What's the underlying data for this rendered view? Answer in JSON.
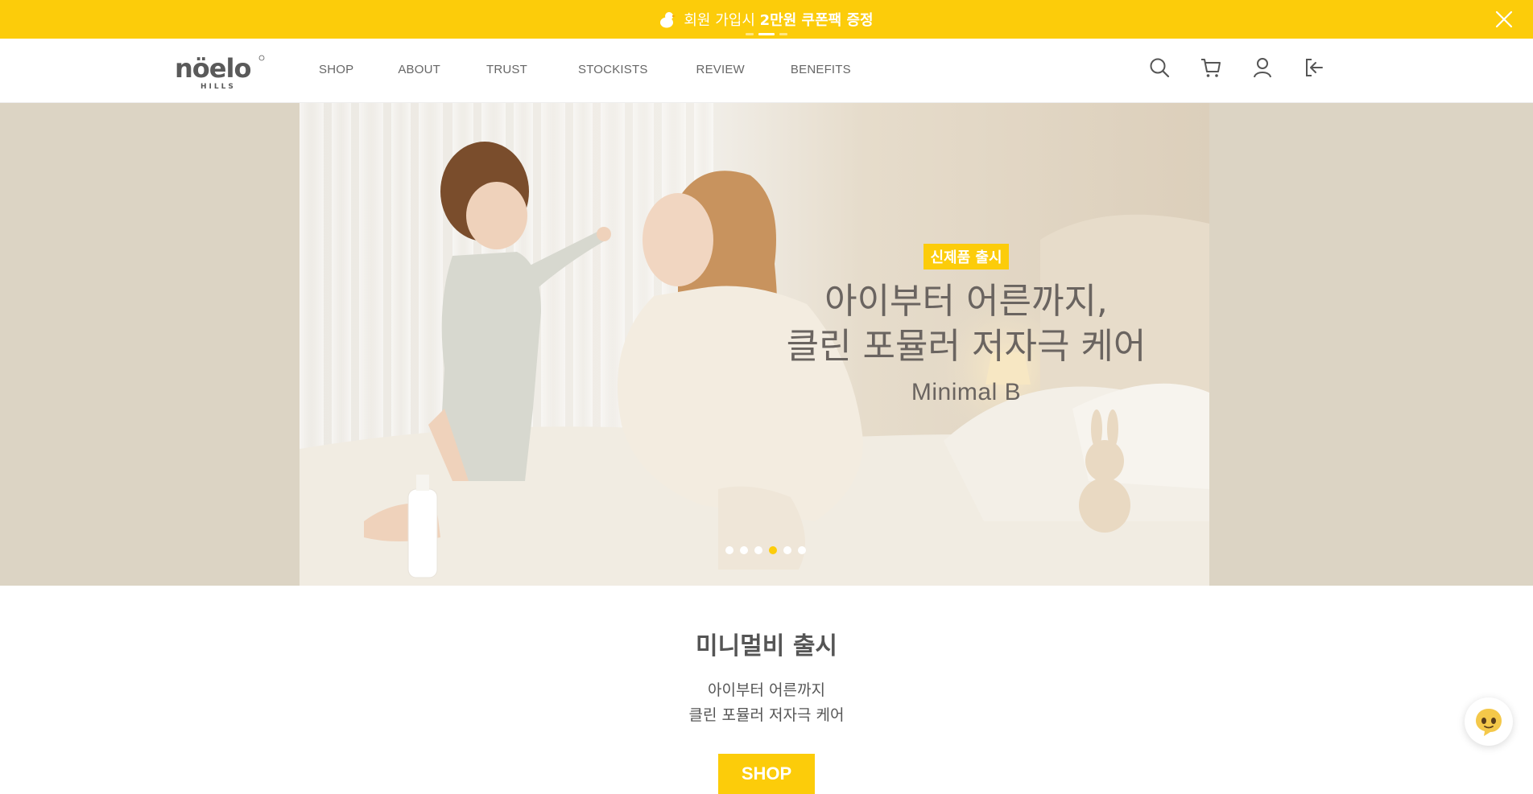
{
  "announcement": {
    "text_regular": "회원 가입시 ",
    "text_bold": "2만원 쿠폰팩 증정",
    "icon": "chick-icon",
    "slide_count": 3,
    "active_slide": 1
  },
  "header": {
    "logo_text": "nöelo",
    "logo_sub": "HILLS",
    "nav": [
      "SHOP",
      "ABOUT",
      "TRUST",
      "STOCKISTS",
      "REVIEW",
      "BENEFITS"
    ],
    "icons": [
      "search-icon",
      "cart-icon",
      "user-icon",
      "logout-icon"
    ]
  },
  "hero": {
    "badge": "신제품 출시",
    "title_line1": "아이부터 어른까지,",
    "title_line2": "클린 포뮬러 저자극 케어",
    "subtitle": "Minimal B",
    "slide_count": 6,
    "active_slide": 3
  },
  "section": {
    "title": "미니멀비 출시",
    "desc_line1": "아이부터 어른까지",
    "desc_line2": "클린 포뮬러 저자극 케어",
    "button": "SHOP"
  },
  "colors": {
    "accent": "#fccc0a",
    "hero_bg": "#dcd4c4",
    "text": "#555555"
  },
  "chat": {
    "icon": "chat-bubble-icon"
  }
}
